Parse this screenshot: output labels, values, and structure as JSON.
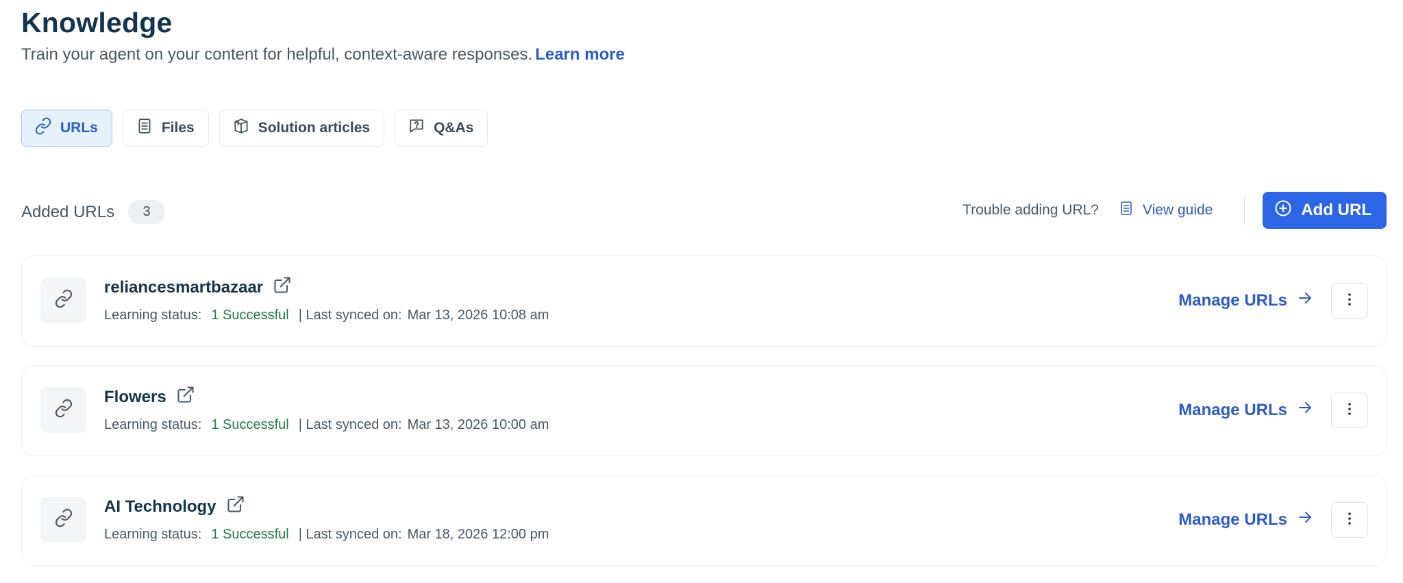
{
  "header": {
    "title": "Knowledge",
    "subtitle": "Train your agent on your content for helpful, context-aware responses.",
    "learn_more": "Learn more"
  },
  "tabs": [
    {
      "label": "URLs",
      "icon": "link-icon",
      "active": true
    },
    {
      "label": "Files",
      "icon": "document-icon",
      "active": false
    },
    {
      "label": "Solution articles",
      "icon": "book-icon",
      "active": false
    },
    {
      "label": "Q&As",
      "icon": "chat-question-icon",
      "active": false
    }
  ],
  "list_header": {
    "label": "Added URLs",
    "count": "3",
    "trouble_text": "Trouble adding URL?",
    "view_guide": "View guide",
    "add_button": "Add URL"
  },
  "urls": [
    {
      "name": "reliancesmartbazaar",
      "status_label": "Learning status:",
      "status_value": "1 Successful",
      "synced_label": "| Last synced on:",
      "synced_value": "Mar 13, 2026 10:08 am",
      "manage_label": "Manage URLs"
    },
    {
      "name": "Flowers",
      "status_label": "Learning status:",
      "status_value": "1 Successful",
      "synced_label": "| Last synced on:",
      "synced_value": "Mar 13, 2026 10:00 am",
      "manage_label": "Manage URLs"
    },
    {
      "name": "AI Technology",
      "status_label": "Learning status:",
      "status_value": "1 Successful",
      "synced_label": "| Last synced on:",
      "synced_value": "Mar 18, 2026 12:00 pm",
      "manage_label": "Manage URLs"
    }
  ],
  "colors": {
    "primary": "#2c66e6",
    "link": "#2c5cc5",
    "success": "#1f7a46",
    "text_dark": "#12344d",
    "text_muted": "#475867",
    "active_tab_bg": "#e5f2fd"
  }
}
